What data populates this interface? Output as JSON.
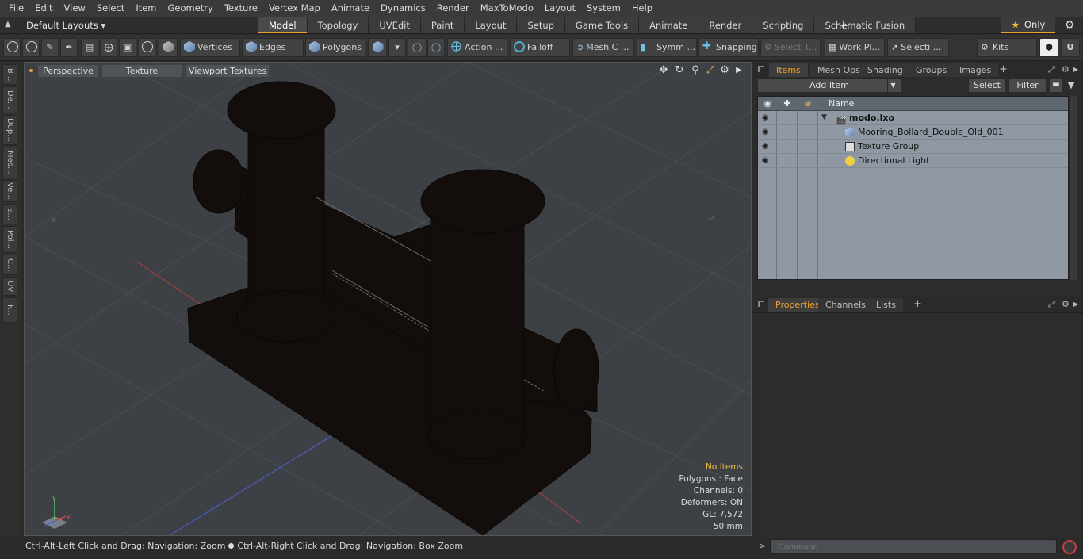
{
  "menu": [
    "File",
    "Edit",
    "View",
    "Select",
    "Item",
    "Geometry",
    "Texture",
    "Vertex Map",
    "Animate",
    "Dynamics",
    "Render",
    "MaxToModo",
    "Layout",
    "System",
    "Help"
  ],
  "layout_dropdown": "Default Layouts",
  "tabs": [
    "Model",
    "Topology",
    "UVEdit",
    "Paint",
    "Layout",
    "Setup",
    "Game Tools",
    "Animate",
    "Render",
    "Scripting",
    "Schematic Fusion"
  ],
  "tab_add": "+",
  "only_label": "Only",
  "toolbar": {
    "vertices": "Vertices",
    "edges": "Edges",
    "polygons": "Polygons",
    "action": "Action ...",
    "falloff": "Falloff",
    "mesh_c": "Mesh C ...",
    "symm": "Symm ...",
    "snapping": "Snapping",
    "select_t": "Select T...",
    "work_pl": "Work Pl...",
    "selecti": "Selecti ...",
    "kits": "Kits"
  },
  "left_tools": [
    "B...",
    "De...",
    "Dup...",
    "Mes...",
    "Ve...",
    "E...",
    "Pol...",
    "C...",
    "UV",
    "F..."
  ],
  "viewport": {
    "perspective": "Perspective",
    "texture": "Texture",
    "viewport_textures": "Viewport Textures",
    "label_x_left": "-X",
    "label_z_right": "-Z",
    "stats": {
      "no_items": "No Items",
      "polygons": "Polygons : Face",
      "channels": "Channels: 0",
      "deformers": "Deformers: ON",
      "gl": "GL: 7,572",
      "size": "50 mm"
    }
  },
  "status": {
    "left": "Ctrl-Alt-Left Click and Drag: Navigation: Zoom",
    "right": "Ctrl-Alt-Right Click and Drag: Navigation: Box Zoom"
  },
  "items_panel": {
    "tabs": [
      "Items",
      "Mesh Ops",
      "Shading",
      "Groups",
      "Images"
    ],
    "add_item": "Add Item",
    "select": "Select",
    "filter": "Filter",
    "column_name": "Name",
    "rows": [
      {
        "label": "modo.lxo",
        "icon": "scene-icon",
        "bold": true
      },
      {
        "label": "Mooring_Bollard_Double_Old_001",
        "icon": "mesh-icon",
        "bold": false
      },
      {
        "label": "Texture Group",
        "icon": "texture-group-icon",
        "bold": false
      },
      {
        "label": "Directional Light",
        "icon": "light-icon",
        "bold": false
      }
    ]
  },
  "props_panel": {
    "tabs": [
      "Properties",
      "Channels",
      "Lists"
    ]
  },
  "command_placeholder": "Command",
  "colors": {
    "accent": "#f0a030",
    "viewport_bg": "#3d4044",
    "list_bg": "#8f98a3"
  }
}
